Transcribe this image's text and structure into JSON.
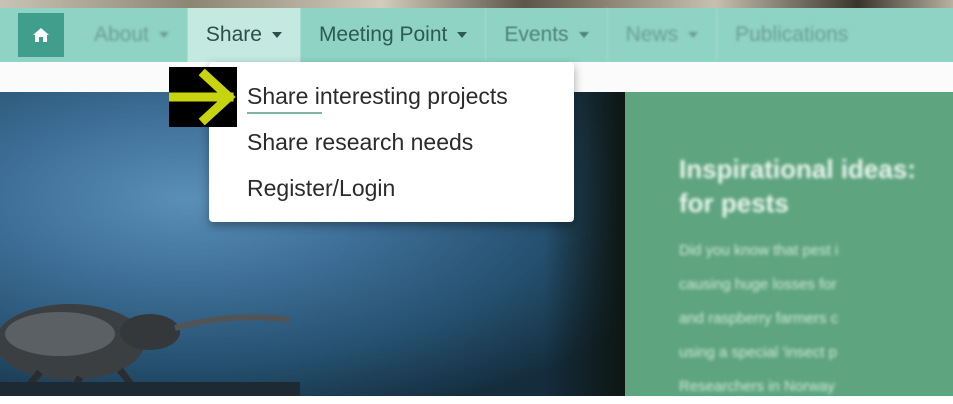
{
  "nav": {
    "items": [
      {
        "label": "About",
        "state": "blurred"
      },
      {
        "label": "Share",
        "state": "active"
      },
      {
        "label": "Meeting Point",
        "state": "clear"
      },
      {
        "label": "Events",
        "state": "blurred"
      },
      {
        "label": "News",
        "state": "blurred"
      },
      {
        "label": "Publications",
        "state": "blurred"
      }
    ]
  },
  "dropdown": {
    "items": [
      {
        "label": "Share interesting projects"
      },
      {
        "label": "Share research needs"
      },
      {
        "label": "Register/Login"
      }
    ]
  },
  "hero": {
    "title_line1": "Inspirational ideas:",
    "title_line2": "for pests",
    "body_lines": [
      "Did you know that pest i",
      "causing huge losses for",
      "and raspberry farmers c",
      "using a special 'insect p",
      "Researchers in Norway"
    ]
  },
  "colors": {
    "nav_bg": "#8fd3c5",
    "home_bg": "#3f9f8c",
    "active_tab_bg": "#c4e9e0",
    "hero_green": "#5ea57f",
    "annotation_arrow": "#c8d40f"
  },
  "icons": {
    "home": "home-icon",
    "dropdown_caret": "caret-down-icon",
    "annotation": "arrow-right-icon"
  }
}
